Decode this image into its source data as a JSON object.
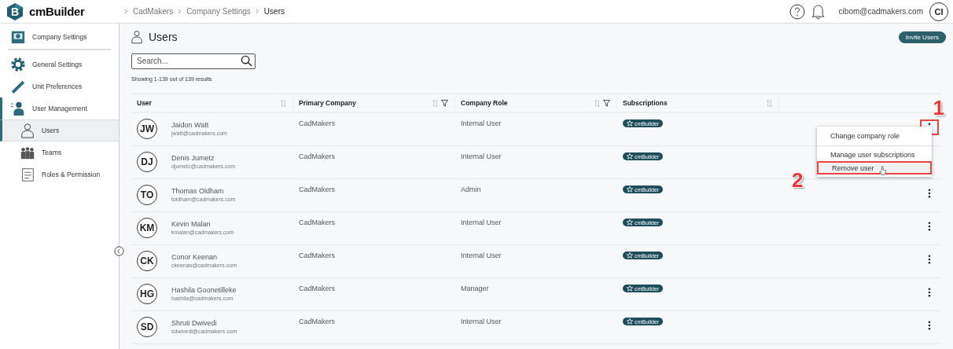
{
  "header": {
    "logo_letter": "B",
    "app_name": "cmBuilder",
    "breadcrumbs": [
      "CadMakers",
      "Company Settings",
      "Users"
    ],
    "user_email": "cibom@cadmakers.com",
    "user_initials": "CI"
  },
  "sidebar": {
    "items": [
      {
        "label": "Company Settings",
        "expanded": false
      },
      {
        "label": "General Settings",
        "expanded": false
      },
      {
        "label": "Unit Preferences",
        "expanded": false
      },
      {
        "label": "User Management",
        "expanded": true,
        "children": [
          {
            "label": "Users",
            "selected": true
          },
          {
            "label": "Teams",
            "selected": false
          },
          {
            "label": "Roles & Permission",
            "selected": false
          }
        ]
      }
    ]
  },
  "page": {
    "title": "Users",
    "invite_button": "Invite Users",
    "search": {
      "placeholder": "Search..."
    },
    "results": "Showing 1-139 out of 139 results"
  },
  "table": {
    "columns": [
      {
        "label": "User",
        "sortable": true,
        "filterable": false
      },
      {
        "label": "Primary Company",
        "sortable": true,
        "filterable": true
      },
      {
        "label": "Company Role",
        "sortable": true,
        "filterable": true
      },
      {
        "label": "Subscriptions",
        "sortable": true,
        "filterable": false
      }
    ],
    "rows": [
      {
        "initials": "JW",
        "name": "Jaidon Watt",
        "email": "jwatt@cadmakers.com",
        "company": "CadMakers",
        "role": "Internal User",
        "subscription": "cmBuilder",
        "menu_open": true,
        "annotation": "1"
      },
      {
        "initials": "DJ",
        "name": "Denis Jumetz",
        "email": "djumetz@cadmakers.com",
        "company": "CadMakers",
        "role": "Internal User",
        "subscription": "cmBuilder",
        "menu_open": false
      },
      {
        "initials": "TO",
        "name": "Thomas Oldham",
        "email": "toldham@cadmakers.com",
        "company": "CadMakers",
        "role": "Admin",
        "subscription": "cmBuilder",
        "menu_open": false
      },
      {
        "initials": "KM",
        "name": "Kevin Malan",
        "email": "kmalan@cadmakers.com",
        "company": "CadMakers",
        "role": "Internal User",
        "subscription": "cmBuilder",
        "menu_open": false
      },
      {
        "initials": "CK",
        "name": "Conor Keenan",
        "email": "ckeenan@cadmakers.com",
        "company": "CadMakers",
        "role": "Internal User",
        "subscription": "cmBuilder",
        "menu_open": false
      },
      {
        "initials": "HG",
        "name": "Hashila Goonetilleke",
        "email": "hashila@cadmakers.com",
        "company": "CadMakers",
        "role": "Manager",
        "subscription": "cmBuilder",
        "menu_open": false
      },
      {
        "initials": "SD",
        "name": "Shruti Dwivedi",
        "email": "sdwivedi@cadmakers.com",
        "company": "CadMakers",
        "role": "Internal User",
        "subscription": "cmBuilder",
        "menu_open": false
      }
    ]
  },
  "row_menu": {
    "items": [
      {
        "label": "Change company role",
        "hovered": false
      },
      {
        "label": "Manage user subscriptions",
        "hovered": false
      },
      {
        "label": "Remove user",
        "hovered": true,
        "annotation": "2"
      }
    ]
  }
}
